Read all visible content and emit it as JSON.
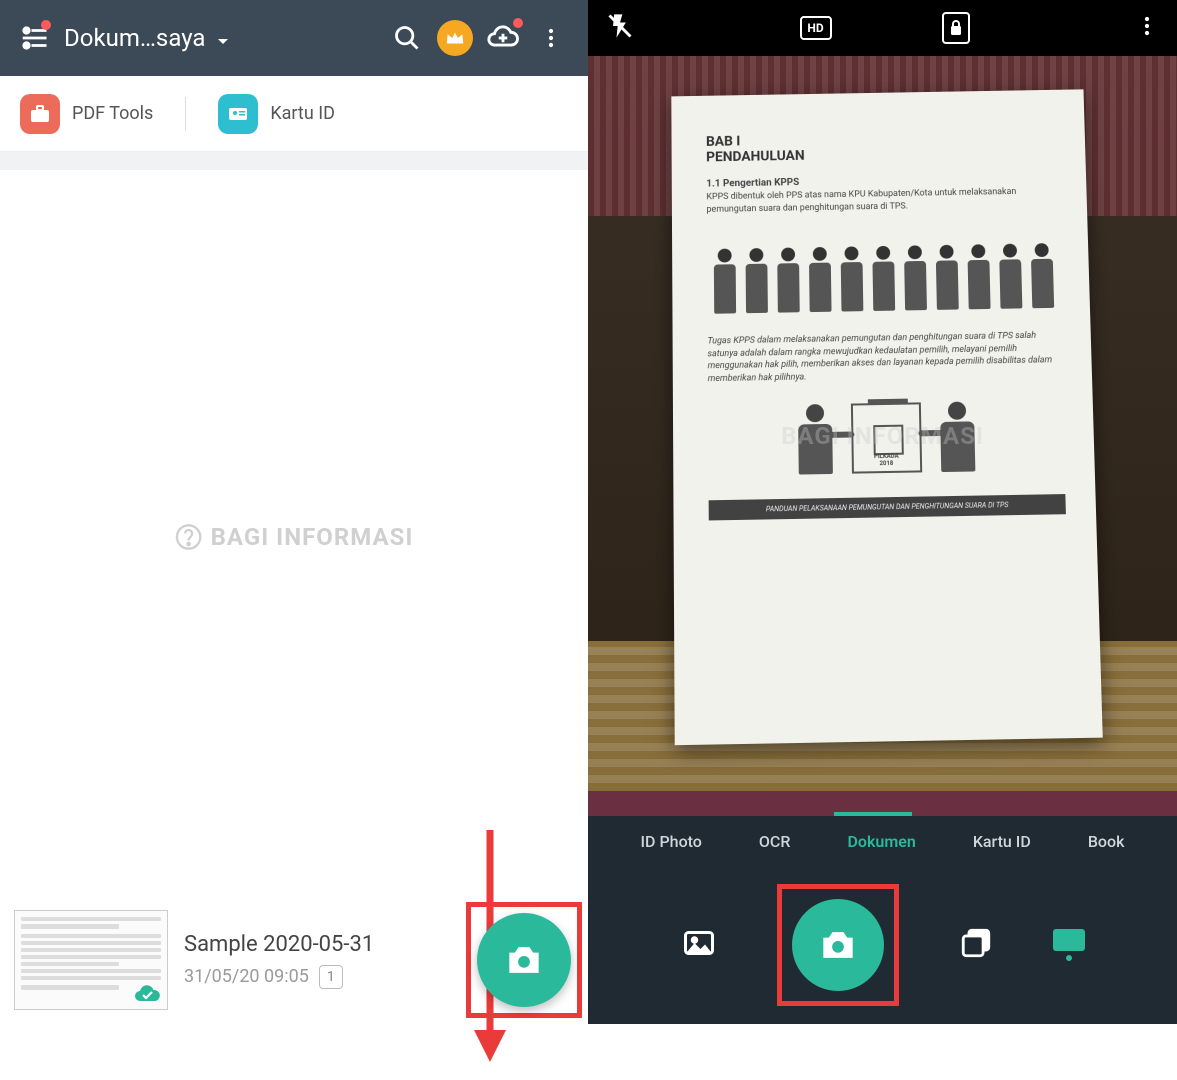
{
  "left": {
    "header": {
      "title": "Dokum…saya"
    },
    "tools": {
      "pdf": "PDF Tools",
      "idcard": "Kartu ID"
    },
    "watermark": "BAGI INFORMASI",
    "sample": {
      "title": "Sample 2020-05-31",
      "datetime": "31/05/20 09:05",
      "pages": "1"
    }
  },
  "right": {
    "hd": "HD",
    "watermark": "BAGI INFORMASI",
    "doc": {
      "chapter": "BAB I",
      "heading": "PENDAHULUAN",
      "section": "1.1 Pengertian KPPS",
      "line1": "KPPS dibentuk oleh PPS atas nama KPU Kabupaten/Kota untuk melaksanakan pemungutan suara dan penghitungan suara di TPS.",
      "para2": "Tugas KPPS dalam melaksanakan pemungutan dan penghitungan suara di TPS salah satunya adalah dalam rangka mewujudkan kedaulatan pemilih, melayani pemilih menggunakan hak pilih, memberikan akses dan layanan kepada pemilih disabilitas dalam memberikan hak pilihnya.",
      "ballot_event_top": "PILKADA",
      "ballot_event_bot": "2018",
      "footer": "PANDUAN PELAKSANAAN PEMUNGUTAN DAN PENGHITUNGAN SUARA DI TPS"
    },
    "modes": {
      "m0": "ID Photo",
      "m1": "OCR",
      "m2": "Dokumen",
      "m3": "Kartu ID",
      "m4": "Book"
    }
  }
}
